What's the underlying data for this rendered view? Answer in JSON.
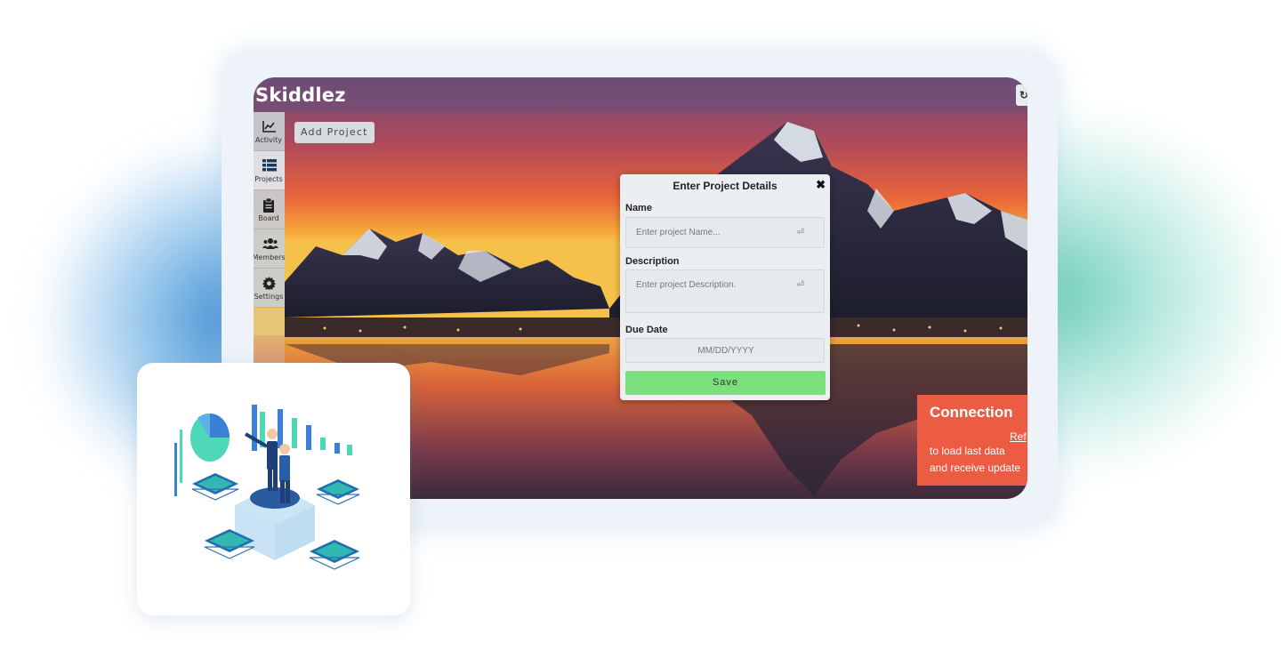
{
  "app": {
    "brand": "Skiddlez",
    "top_button_glyph": "↻"
  },
  "sidebar": {
    "items": [
      {
        "label": "Activity",
        "icon": "chart-line-icon"
      },
      {
        "label": "Projects",
        "icon": "list-icon"
      },
      {
        "label": "Board",
        "icon": "clipboard-icon"
      },
      {
        "label": "Members",
        "icon": "users-icon"
      },
      {
        "label": "Settings",
        "icon": "gear-icon"
      }
    ],
    "active": "Projects"
  },
  "toolbar": {
    "add_project_label": "Add Project"
  },
  "modal": {
    "title": "Enter Project Details",
    "close_glyph": "✖",
    "name_label": "Name",
    "name_placeholder": "Enter project Name...",
    "description_label": "Description",
    "description_placeholder": "Enter project Description.",
    "due_date_label": "Due Date",
    "due_date_placeholder": "MM/DD/YYYY",
    "save_label": "Save",
    "field_glyph": "⏎"
  },
  "toast": {
    "title": "Connection",
    "link": "Ref",
    "line1": "to load last data",
    "line2": "and receive update"
  },
  "colors": {
    "save": "#7be07b",
    "toast": "#ec5c43",
    "device_frame": "#edf3f9"
  }
}
